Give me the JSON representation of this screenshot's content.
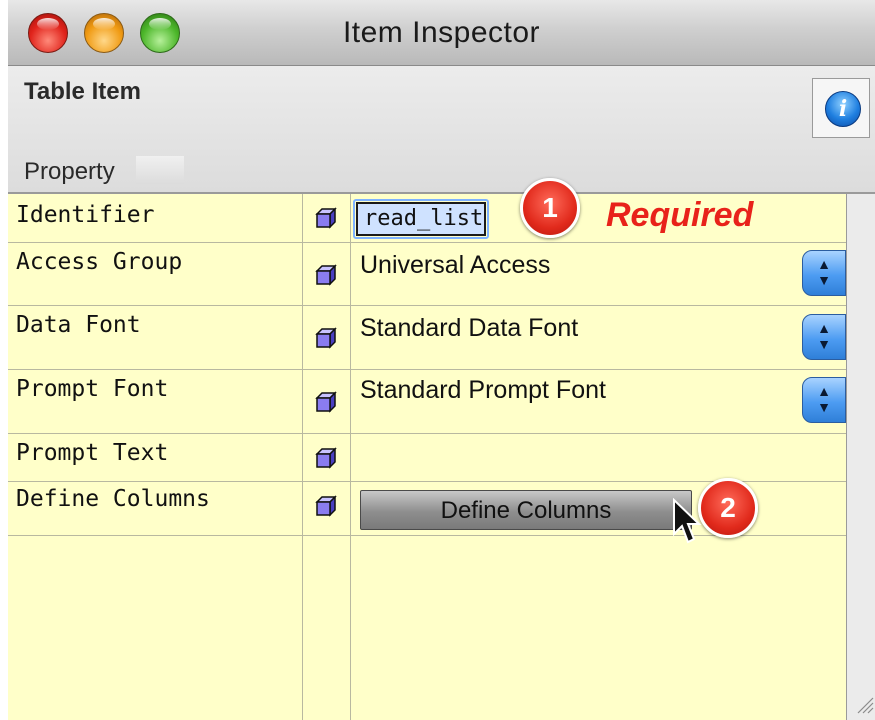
{
  "window": {
    "title": "Item Inspector"
  },
  "header": {
    "item_type": "Table Item",
    "column_header": "Property",
    "info_icon_glyph": "i"
  },
  "rows": [
    {
      "label": "Identifier",
      "value": "read_list",
      "kind": "text-field"
    },
    {
      "label": "Access Group",
      "value": "Universal Access",
      "kind": "popup"
    },
    {
      "label": "Data Font",
      "value": "Standard Data Font",
      "kind": "popup"
    },
    {
      "label": "Prompt Font",
      "value": "Standard Prompt Font",
      "kind": "popup"
    },
    {
      "label": "Prompt Text",
      "value": "",
      "kind": "empty"
    },
    {
      "label": "Define Columns",
      "value": "Define Columns",
      "kind": "button"
    }
  ],
  "annotations": {
    "callout_1": "1",
    "callout_2": "2",
    "required_label": "Required"
  },
  "colors": {
    "grid_background": "#ffffc9",
    "required_text": "#e8221a",
    "callout_fill": "#e12a1c",
    "cube_fill": "#8a7cf0"
  },
  "icons": {
    "row_icon": "cube-icon",
    "info": "info-icon",
    "popup": "stepper-arrows-icon",
    "cursor": "mouse-pointer-icon"
  }
}
